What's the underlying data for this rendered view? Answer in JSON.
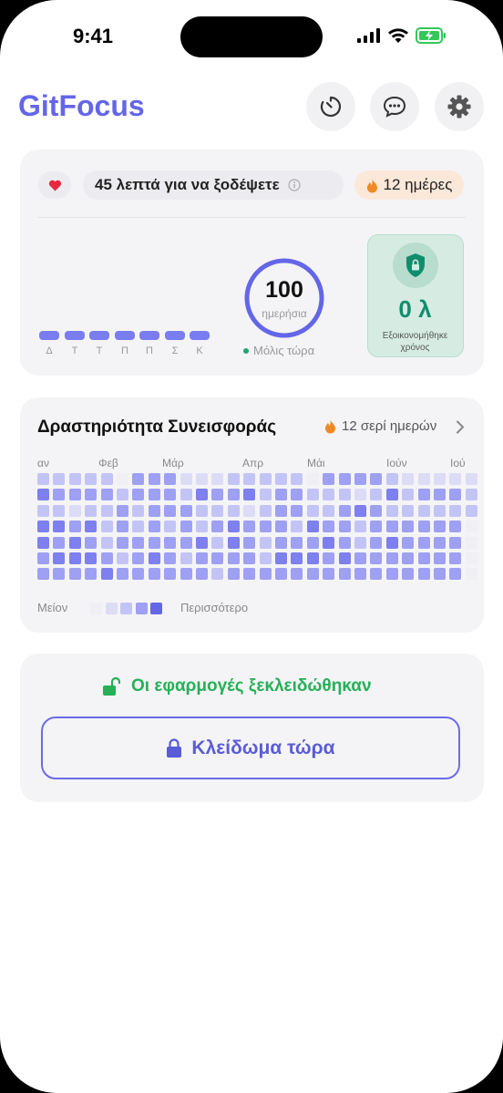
{
  "status_bar": {
    "time": "9:41"
  },
  "header": {
    "app_title": "GitFocus"
  },
  "focus_card": {
    "earn_text": "45 λεπτά για να ξοδέψετε",
    "streak_badge": "12 ημέρες",
    "week_days": [
      "Δ",
      "Τ",
      "Τ",
      "Π",
      "Π",
      "Σ",
      "Κ"
    ],
    "daily_value": "100",
    "daily_label": "ημερήσια",
    "updated_text": "Μόλις τώρα",
    "saved_value": "0 λ",
    "saved_label": "Εξοικονομήθηκε χρόνος",
    "accent_color": "#6466e8",
    "saved_color": "#0f8e6c"
  },
  "activity_card": {
    "title": "Δραστηριότητα Συνεισφοράς",
    "streak_text": "12 σερί ημερών",
    "months": [
      "αν",
      "Φεβ",
      "Μάρ",
      "Απρ",
      "Μάι",
      "Ιούν",
      "Ιού"
    ],
    "legend_less": "Μείον",
    "legend_more": "Περισσότερο",
    "levels": [
      [
        2,
        2,
        2,
        2,
        2,
        0,
        3,
        3,
        3,
        1,
        1,
        1,
        2,
        2,
        2,
        2,
        2,
        0,
        3,
        3,
        3,
        3,
        2,
        1,
        1,
        1,
        1,
        1
      ],
      [
        4,
        3,
        3,
        3,
        3,
        2,
        3,
        3,
        3,
        2,
        4,
        3,
        3,
        4,
        2,
        3,
        3,
        2,
        2,
        2,
        1,
        2,
        4,
        2,
        3,
        3,
        3,
        2
      ],
      [
        2,
        2,
        1,
        2,
        2,
        3,
        2,
        3,
        3,
        3,
        2,
        2,
        2,
        1,
        2,
        3,
        3,
        2,
        2,
        3,
        4,
        3,
        2,
        2,
        2,
        2,
        2,
        2
      ],
      [
        4,
        4,
        3,
        4,
        2,
        3,
        2,
        3,
        2,
        3,
        2,
        3,
        4,
        3,
        3,
        3,
        2,
        4,
        3,
        3,
        2,
        3,
        3,
        3,
        3,
        3,
        3,
        0
      ],
      [
        4,
        3,
        4,
        3,
        2,
        3,
        3,
        3,
        3,
        3,
        4,
        2,
        4,
        3,
        2,
        3,
        3,
        3,
        4,
        3,
        2,
        3,
        4,
        3,
        3,
        3,
        3,
        0
      ],
      [
        3,
        4,
        4,
        4,
        3,
        2,
        3,
        4,
        3,
        2,
        3,
        3,
        3,
        3,
        2,
        4,
        4,
        4,
        3,
        4,
        3,
        3,
        3,
        3,
        3,
        3,
        3,
        0
      ],
      [
        3,
        3,
        3,
        3,
        4,
        3,
        3,
        3,
        3,
        3,
        3,
        2,
        3,
        3,
        3,
        3,
        3,
        3,
        3,
        3,
        3,
        3,
        3,
        3,
        3,
        3,
        3,
        0
      ]
    ],
    "level_colors": [
      "#efeff4",
      "#dcdcf6",
      "#c3c4f6",
      "#9ea0f3",
      "#7d80ee"
    ]
  },
  "unlock_card": {
    "status_text": "Οι εφαρμογές ξεκλειδώθηκαν",
    "lock_button_label": "Κλείδωμα τώρα",
    "status_color": "#26b057"
  }
}
